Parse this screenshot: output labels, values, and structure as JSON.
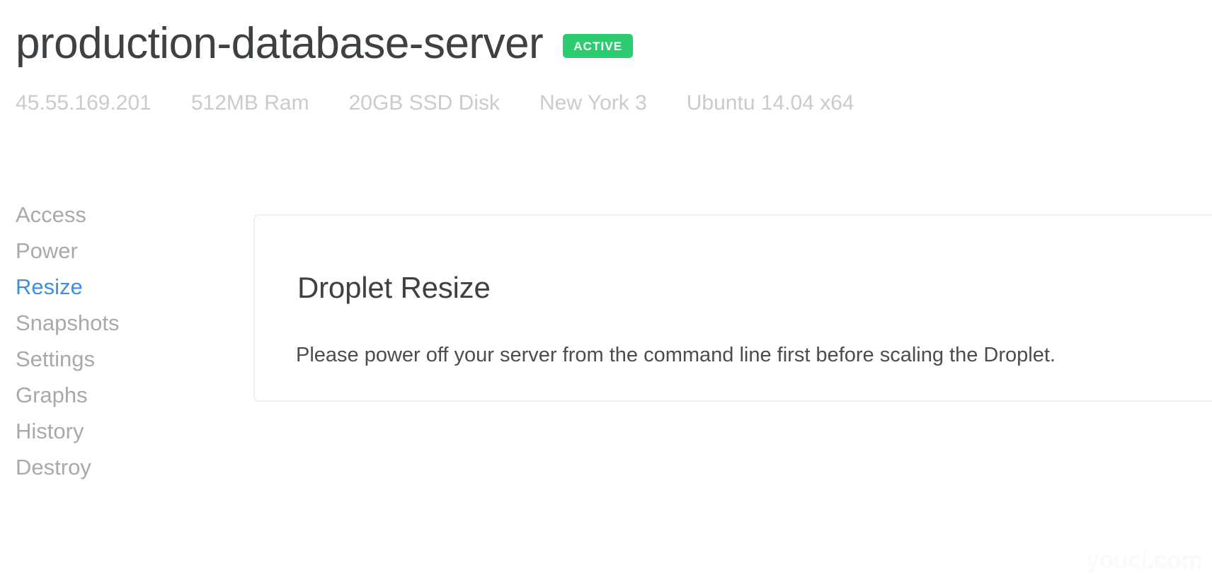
{
  "header": {
    "title": "production-database-server",
    "status_badge": "ACTIVE",
    "status_color": "#2ecc71",
    "meta": [
      "45.55.169.201",
      "512MB Ram",
      "20GB SSD Disk",
      "New York 3",
      "Ubuntu 14.04 x64"
    ]
  },
  "sidebar": {
    "active_color": "#3d8fe0",
    "items": [
      {
        "label": "Access",
        "active": false
      },
      {
        "label": "Power",
        "active": false
      },
      {
        "label": "Resize",
        "active": true
      },
      {
        "label": "Snapshots",
        "active": false
      },
      {
        "label": "Settings",
        "active": false
      },
      {
        "label": "Graphs",
        "active": false
      },
      {
        "label": "History",
        "active": false
      },
      {
        "label": "Destroy",
        "active": false
      }
    ]
  },
  "main": {
    "card": {
      "heading": "Droplet Resize",
      "body": "Please power off your server from the command line first before scaling the Droplet."
    }
  },
  "watermark": {
    "text": "youci.com"
  }
}
